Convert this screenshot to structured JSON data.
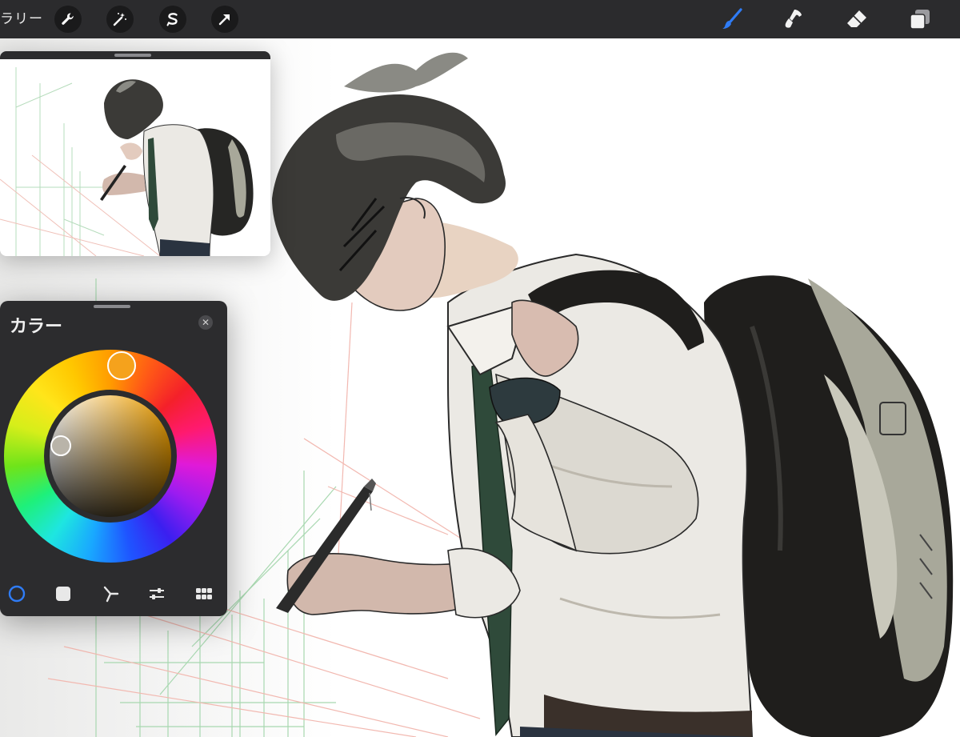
{
  "toolbar": {
    "gallery_label": "ラリー",
    "left_tools": [
      {
        "icon": "wrench-icon"
      },
      {
        "icon": "magic-wand-icon"
      },
      {
        "icon": "selection-icon"
      },
      {
        "icon": "transform-arrow-icon"
      }
    ],
    "right_tools": [
      {
        "icon": "brush-icon",
        "active": true
      },
      {
        "icon": "smudge-icon"
      },
      {
        "icon": "eraser-icon"
      },
      {
        "icon": "layers-icon"
      }
    ],
    "active_color": "#2f7cf6"
  },
  "reference_window": {
    "icon": "reference-thumbnail"
  },
  "color_panel": {
    "title": "カラー",
    "close_icon": "✕",
    "selected_hue_color": "#f5a21c",
    "selected_color": "#b9b4a9",
    "modes": [
      {
        "icon": "disc-mode-icon",
        "active": true
      },
      {
        "icon": "classic-mode-icon"
      },
      {
        "icon": "harmony-mode-icon"
      },
      {
        "icon": "value-mode-icon"
      },
      {
        "icon": "palettes-mode-icon"
      }
    ]
  }
}
